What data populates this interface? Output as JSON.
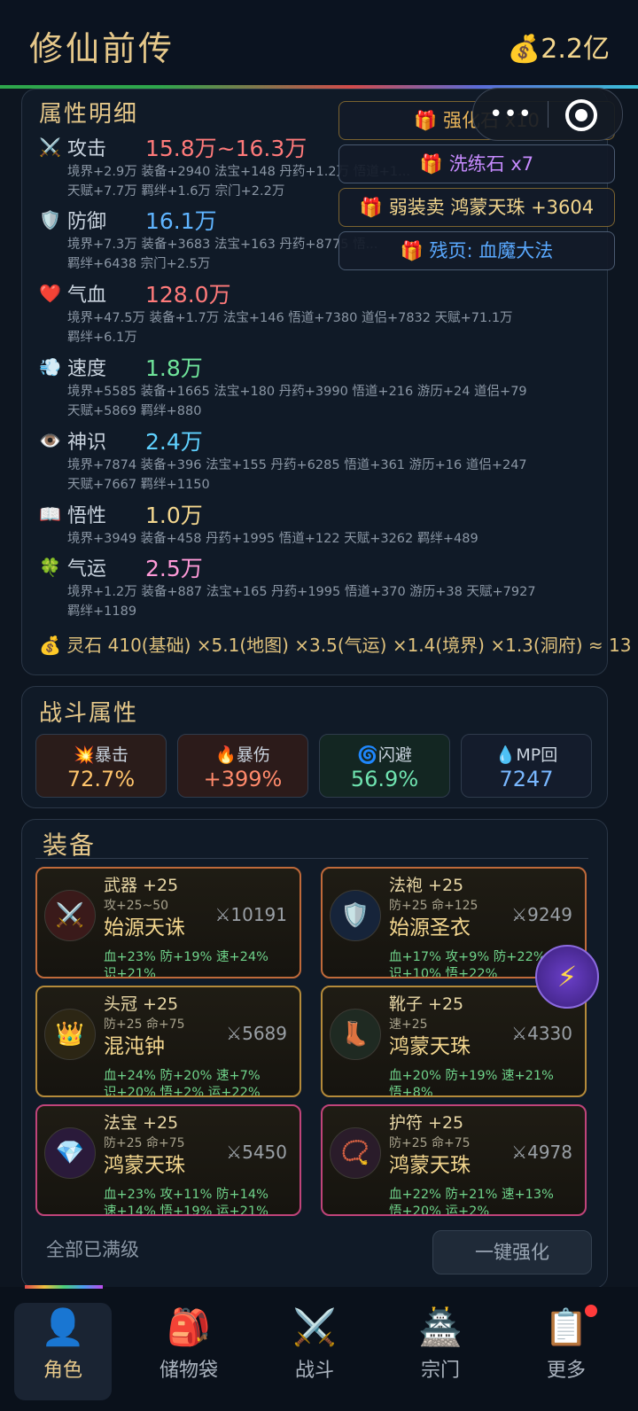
{
  "header": {
    "title": "修仙前传",
    "gold": "2.2亿",
    "gold_icon": "money-bag"
  },
  "popups": [
    {
      "label": "强化石 x10",
      "color": "#e8b45a"
    },
    {
      "label": "洗练石 x7",
      "color": "#c78bff"
    },
    {
      "label": "弱装卖 鸿蒙天珠 +3604",
      "color": "#f3d68e"
    },
    {
      "label": "残页: 血魔大法",
      "color": "#5aa9ff"
    }
  ],
  "attributes": {
    "title": "属性明细",
    "rows": [
      {
        "name": "攻击",
        "value": "15.8万~16.3万",
        "icon": "swords",
        "color": "#ff7a7a",
        "detail1": "境界+2.9万  装备+2940  法宝+148  丹药+1.2万  悟道+1...",
        "detail2": "天赋+7.7万  羁绊+1.6万  宗门+2.2万"
      },
      {
        "name": "防御",
        "value": "16.1万",
        "icon": "shield",
        "color": "#5fb4ff",
        "detail1": "境界+7.3万  装备+3683  法宝+163  丹药+8775  悟...",
        "detail2": "羁绊+6438  宗门+2.5万"
      },
      {
        "name": "气血",
        "value": "128.0万",
        "icon": "heart",
        "color": "#ff7a7a",
        "detail1": "境界+47.5万  装备+1.7万  法宝+146  悟道+7380  道侣+7832  天赋+71.1万",
        "detail2": "羁绊+6.1万"
      },
      {
        "name": "速度",
        "value": "1.8万",
        "icon": "wind",
        "color": "#6fe39a",
        "detail1": "境界+5585  装备+1665  法宝+180  丹药+3990  悟道+216  游历+24  道侣+79",
        "detail2": "天赋+5869  羁绊+880"
      },
      {
        "name": "神识",
        "value": "2.4万",
        "icon": "eye",
        "color": "#5fd1ff",
        "detail1": "境界+7874  装备+396  法宝+155  丹药+6285  悟道+361  游历+16  道侣+247",
        "detail2": "天赋+7667  羁绊+1150"
      },
      {
        "name": "悟性",
        "value": "1.0万",
        "icon": "book",
        "color": "#f3d68e",
        "detail1": "境界+3949  装备+458  丹药+1995  悟道+122  天赋+3262  羁绊+489",
        "detail2": ""
      },
      {
        "name": "气运",
        "value": "2.5万",
        "icon": "clover",
        "color": "#ff9ad8",
        "detail1": "境界+1.2万  装备+887  法宝+165  丹药+1995  悟道+370  游历+38  天赋+7927",
        "detail2": "羁绊+1189"
      }
    ],
    "spirit_stone": "灵石  410(基础) ×5.1(地图) ×3.5(气运) ×1.4(境界) ×1.3(洞府) ≈ 13"
  },
  "combat": {
    "title": "战斗属性",
    "stats": [
      {
        "label": "暴击",
        "value": "72.7%",
        "icon": "💥",
        "color": "#ffc46b"
      },
      {
        "label": "暴伤",
        "value": "+399%",
        "icon": "🔥",
        "color": "#ff8a6b"
      },
      {
        "label": "闪避",
        "value": "56.9%",
        "icon": "🌀",
        "color": "#6fe3b0"
      },
      {
        "label": "MP回",
        "value": "7247",
        "icon": "💧",
        "color": "#7ab8ff"
      }
    ]
  },
  "equipment": {
    "title": "装备",
    "items": [
      {
        "slot": "武器 +25",
        "base": "攻+25~50",
        "name": "始源天诛",
        "power": "10191",
        "icon": "⚔️",
        "bonus1": "血+23% 防+19% 速+24%",
        "bonus2": "识+21%"
      },
      {
        "slot": "法袍 +25",
        "base": "防+25 命+125",
        "name": "始源圣衣",
        "power": "9249",
        "icon": "🛡️",
        "bonus1": "血+17% 攻+9% 防+22%",
        "bonus2": "识+10% 悟+22%"
      },
      {
        "slot": "头冠 +25",
        "base": "防+25 命+75",
        "name": "混沌钟",
        "power": "5689",
        "icon": "👑",
        "bonus1": "血+24% 防+20% 速+7%",
        "bonus2": "识+20% 悟+2% 运+22%"
      },
      {
        "slot": "靴子 +25",
        "base": "速+25",
        "name": "鸿蒙天珠",
        "power": "4330",
        "icon": "👢",
        "bonus1": "血+20% 防+19% 速+21%",
        "bonus2": "悟+8%"
      },
      {
        "slot": "法宝 +25",
        "base": "防+25 命+75",
        "name": "鸿蒙天珠",
        "power": "5450",
        "icon": "💎",
        "bonus1": "血+23% 攻+11% 防+14%",
        "bonus2": "速+14% 悟+19% 运+21%"
      },
      {
        "slot": "护符 +25",
        "base": "防+25 命+75",
        "name": "鸿蒙天珠",
        "power": "4978",
        "icon": "📿",
        "bonus1": "血+22% 防+21% 速+13%",
        "bonus2": "悟+20% 运+2%"
      }
    ],
    "status": "全部已满级",
    "upgrade_button": "一键强化"
  },
  "nav": [
    {
      "label": "角色",
      "icon": "👤",
      "active": true
    },
    {
      "label": "储物袋",
      "icon": "🎒",
      "active": false
    },
    {
      "label": "战斗",
      "icon": "⚔️",
      "active": false
    },
    {
      "label": "宗门",
      "icon": "🏯",
      "active": false
    },
    {
      "label": "更多",
      "icon": "📋",
      "active": false,
      "badge": true
    }
  ],
  "fab_icon": "⚡"
}
